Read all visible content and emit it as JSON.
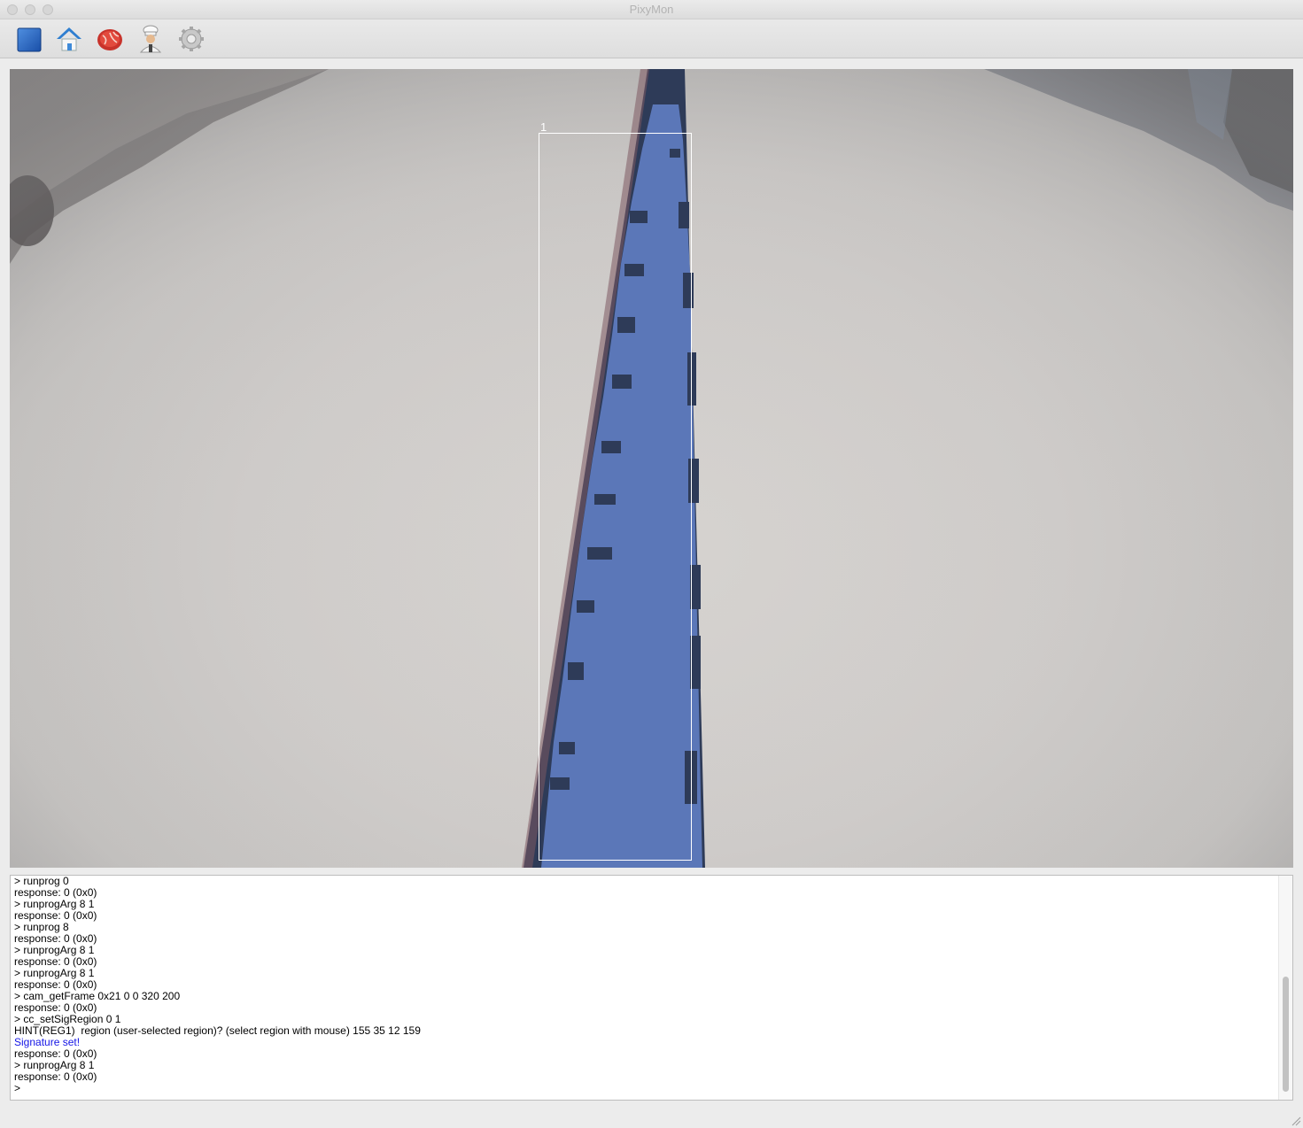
{
  "window": {
    "title": "PixyMon"
  },
  "toolbar": {
    "buttons": [
      {
        "name": "stop-button",
        "icon": "blue-square-icon"
      },
      {
        "name": "home-button",
        "icon": "home-icon"
      },
      {
        "name": "raw-video-button",
        "icon": "meat-icon"
      },
      {
        "name": "chef-button",
        "icon": "chef-icon"
      },
      {
        "name": "settings-button",
        "icon": "gear-icon"
      }
    ]
  },
  "camera": {
    "region_label": "1"
  },
  "console": {
    "lines": [
      {
        "text": "> runprog 0"
      },
      {
        "text": "response: 0 (0x0)"
      },
      {
        "text": "> runprogArg 8 1"
      },
      {
        "text": "response: 0 (0x0)"
      },
      {
        "text": "> runprog 8"
      },
      {
        "text": "response: 0 (0x0)"
      },
      {
        "text": "> runprogArg 8 1"
      },
      {
        "text": "response: 0 (0x0)"
      },
      {
        "text": "> runprogArg 8 1"
      },
      {
        "text": "response: 0 (0x0)"
      },
      {
        "text": "> cam_getFrame 0x21 0 0 320 200"
      },
      {
        "text": "response: 0 (0x0)"
      },
      {
        "text": "> cc_setSigRegion 0 1"
      },
      {
        "text": "HINT(REG1)  region (user-selected region)? (select region with mouse) 155 35 12 159"
      },
      {
        "text": "Signature set!",
        "highlight": true
      },
      {
        "text": "response: 0 (0x0)"
      },
      {
        "text": "> runprogArg 8 1"
      },
      {
        "text": "response: 0 (0x0)"
      },
      {
        "text": ">"
      }
    ]
  },
  "colors": {
    "signature_text": "#1414e6",
    "tape_overlay": "#5b77b8",
    "tape_dark": "#2e3b58"
  }
}
